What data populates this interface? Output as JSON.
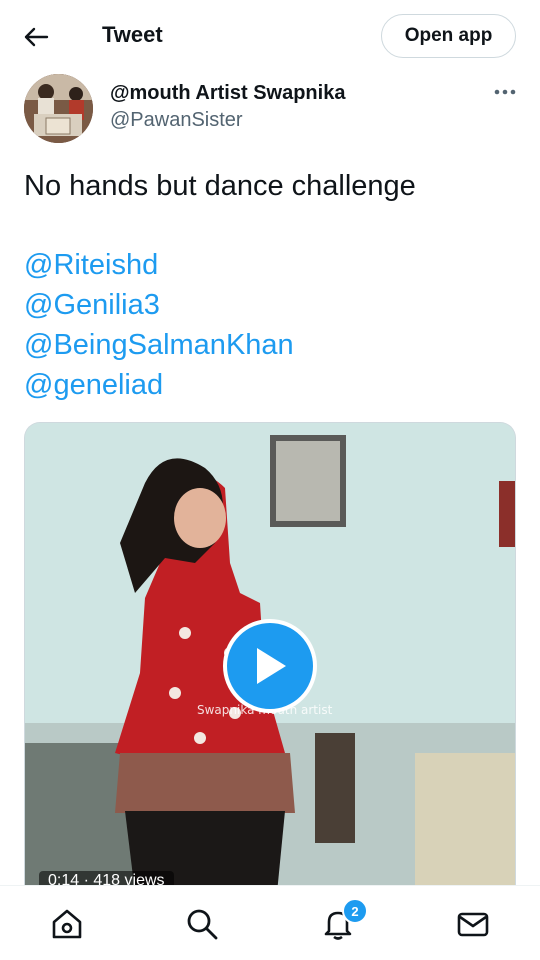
{
  "header": {
    "title": "Tweet",
    "open_app_label": "Open app",
    "back_icon": "arrow-left-icon"
  },
  "author": {
    "display_name": "@mouth Artist Swapnika",
    "handle": "@PawanSister",
    "more_icon": "more-horizontal-icon"
  },
  "tweet": {
    "text": "No hands but dance challenge",
    "mentions": [
      "@Riteishd",
      "@Genilia3",
      "@BeingSalmanKhan",
      "@geneliad"
    ]
  },
  "media": {
    "watermark": "Swapnika mouth artist",
    "duration": "0:14",
    "views": "418 views",
    "meta_separator": "·"
  },
  "tabbar": {
    "items": [
      "home-icon",
      "search-icon",
      "notifications-icon",
      "messages-icon"
    ],
    "notification_count": "2"
  },
  "colors": {
    "accent": "#1d9bf0",
    "text": "#0f1419",
    "secondary_text": "#536471",
    "border": "#cfd9de"
  }
}
